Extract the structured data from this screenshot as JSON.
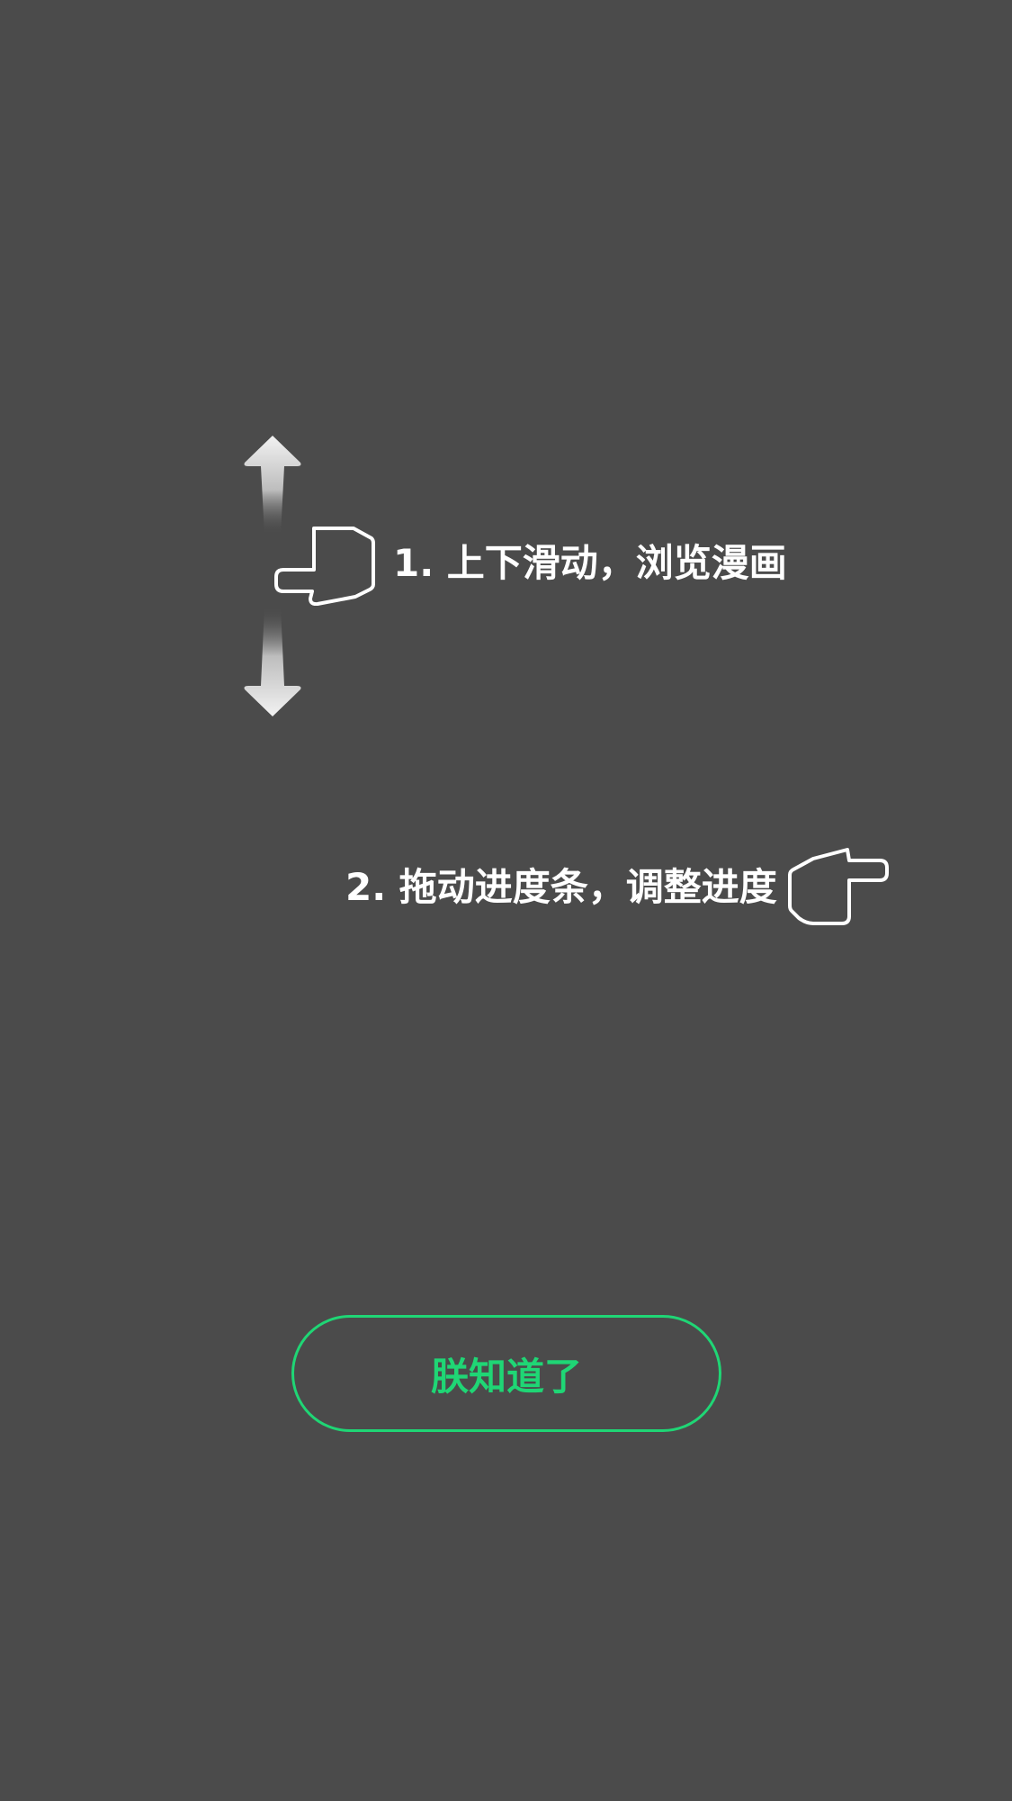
{
  "guide": {
    "tip1": "1. 上下滑动，浏览漫画",
    "tip2": "2. 拖动进度条，调整进度",
    "confirm_label": "朕知道了"
  },
  "icons": {
    "vertical_arrows": "up-down-arrows-icon",
    "hand_left": "pointing-hand-left-icon",
    "hand_right": "pointing-hand-right-icon"
  },
  "colors": {
    "background": "#4b4b4b",
    "text": "#ffffff",
    "accent": "#1fd675"
  }
}
